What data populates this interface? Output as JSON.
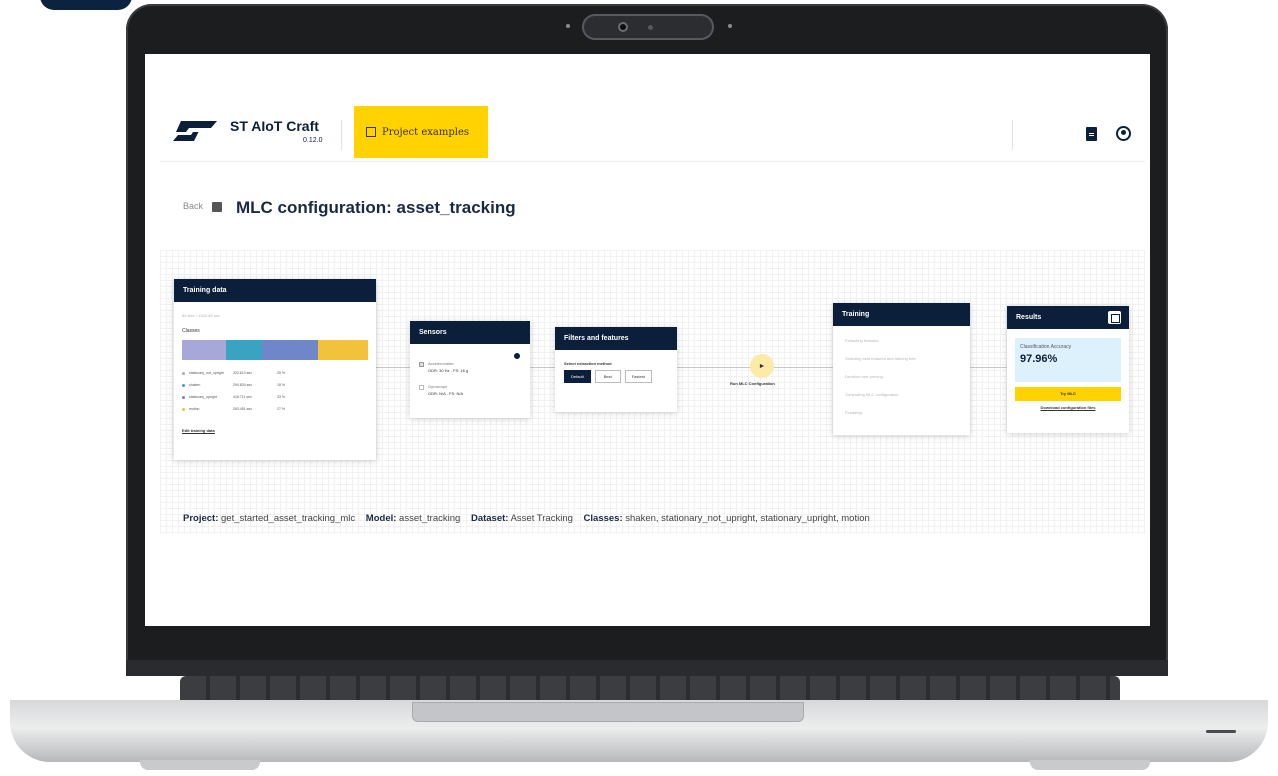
{
  "app": {
    "title": "ST AIoT Craft",
    "version": "0.12.0",
    "project_examples": "Project examples"
  },
  "page": {
    "back": "Back",
    "title": "MLC configuration: asset_tracking"
  },
  "training_data": {
    "title": "Training data",
    "summary": "84 files / 1300.48 sec",
    "classes_label": "Classes",
    "bar_colors": [
      "#a8a8d8",
      "#3aa3c2",
      "#6f86c9",
      "#f2c33a"
    ],
    "classes": [
      {
        "name": "stationary_not_upright",
        "duration": "323.610 sec",
        "pct": "25 %",
        "color": "#a8a8d8"
      },
      {
        "name": "shaken",
        "duration": "294.830 sec",
        "pct": "18 %",
        "color": "#3aa3c2"
      },
      {
        "name": "stationary_upright",
        "duration": "418.711 sec",
        "pct": "33 %",
        "color": "#6f86c9"
      },
      {
        "name": "motion",
        "duration": "263.451 sec",
        "pct": "27 %",
        "color": "#f2c33a"
      }
    ],
    "edit_label": "Edit training data"
  },
  "sensors": {
    "title": "Sensors",
    "items": [
      {
        "name": "Accelerometer",
        "detail": "ODR: 30 Hz - FS: 16 g"
      },
      {
        "name": "Gyroscope",
        "detail": "ODR: N/A - FS: N/A"
      }
    ]
  },
  "filters": {
    "title": "Filters and features",
    "method_label": "Select extraction method",
    "options": [
      "Default",
      "Best",
      "Fastest"
    ]
  },
  "run": {
    "label": "Run MLC Configuration"
  },
  "training": {
    "title": "Training",
    "steps": [
      "Extracting features",
      "Selecting best features and training tree",
      "Decision tree pruning",
      "Generating MLC configuration",
      "Finalizing"
    ]
  },
  "results": {
    "title": "Results",
    "accuracy_label": "Classification Accuracy",
    "accuracy_value": "97.96%",
    "flash_label": "Try MLC",
    "download_label": "Download configuration files"
  },
  "footer": {
    "project_label": "Project:",
    "project_value": "get_started_asset_tracking_mlc",
    "model_label": "Model:",
    "model_value": "asset_tracking",
    "dataset_label": "Dataset:",
    "dataset_value": "Asset Tracking",
    "classes_label": "Classes:",
    "classes_value": "shaken, stationary_not_upright, stationary_upright, motion"
  }
}
